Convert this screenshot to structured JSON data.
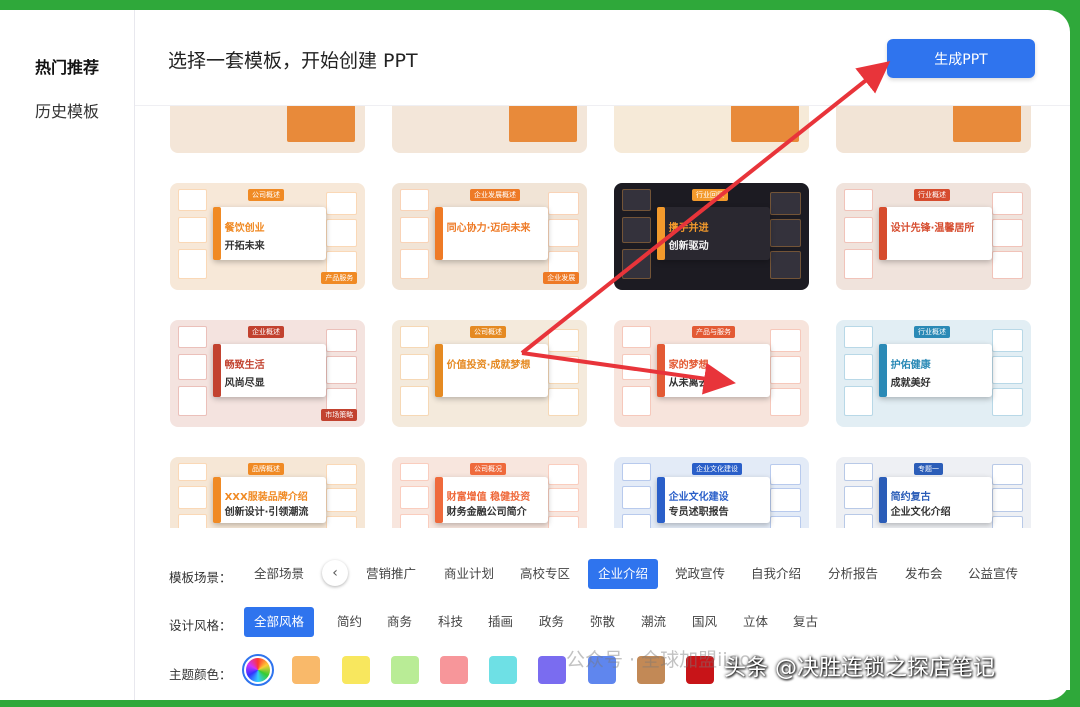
{
  "sidebar": {
    "items": [
      {
        "label": "热门推荐",
        "active": true
      },
      {
        "label": "历史模板",
        "active": false
      }
    ]
  },
  "header": {
    "title": "选择一套模板，开始创建 PPT",
    "generate_label": "生成PPT"
  },
  "templates": [
    {
      "headline": "餐饮创业",
      "subline": "开拓未来",
      "badge": "公司概述",
      "footer": "产品服务",
      "bg": "#f7e8d8",
      "accent": "#f08a24"
    },
    {
      "headline": "同心协力·迈向未来",
      "subline": "",
      "badge": "企业发展概述",
      "footer": "企业发展",
      "bg": "#f1e4d6",
      "accent": "#ee7a26"
    },
    {
      "headline": "携手并进",
      "subline": "创新驱动",
      "badge": "行业回顾",
      "footer": "",
      "bg": "#1c1b22",
      "accent": "#f39a2c"
    },
    {
      "headline": "设计先锋·温馨居所",
      "subline": "",
      "badge": "行业概述",
      "footer": "",
      "bg": "#f0e3dc",
      "accent": "#d64c2e"
    },
    {
      "headline": "畅致生活",
      "subline": "风尚尽显",
      "badge": "企业概述",
      "footer": "市场策略",
      "bg": "#f4e3df",
      "accent": "#c2422f"
    },
    {
      "headline": "价值投资·成就梦想",
      "subline": "",
      "badge": "公司概述",
      "footer": "",
      "bg": "#f4eadc",
      "accent": "#e58a22"
    },
    {
      "headline": "家的梦想",
      "subline": "从未离去",
      "badge": "产品与服务",
      "footer": "",
      "bg": "#f7e4dc",
      "accent": "#e35a34"
    },
    {
      "headline": "护佑健康",
      "subline": "成就美好",
      "badge": "行业概述",
      "footer": "",
      "bg": "#e2eef4",
      "accent": "#2b8ab6"
    },
    {
      "headline": "XXX服装品牌介绍",
      "subline": "创新设计·引领潮流",
      "badge": "品牌概述",
      "footer": "",
      "bg": "#f6e7d6",
      "accent": "#f08a24"
    },
    {
      "headline": "财富增值 稳健投资",
      "subline": "财务金融公司简介",
      "badge": "公司概况",
      "footer": "",
      "bg": "#f8e6de",
      "accent": "#ef6a3c"
    },
    {
      "headline": "企业文化建设",
      "subline": "专员述职报告",
      "badge": "企业文化建设",
      "footer": "",
      "bg": "#e3ebf7",
      "accent": "#2a5fc9"
    },
    {
      "headline": "简约复古",
      "subline": "企业文化介绍",
      "badge": "专题一",
      "footer": "",
      "bg": "#eef0f4",
      "accent": "#2b5db8"
    }
  ],
  "filters": {
    "scene": {
      "label": "模板场景：",
      "options": [
        "全部场景",
        "营销推广",
        "商业计划",
        "高校专区",
        "企业介绍",
        "党政宣传",
        "自我介绍",
        "分析报告",
        "发布会",
        "公益宣传"
      ],
      "selected": "企业介绍"
    },
    "style": {
      "label": "设计风格：",
      "options": [
        "全部风格",
        "简约",
        "商务",
        "科技",
        "插画",
        "政务",
        "弥散",
        "潮流",
        "国风",
        "立体",
        "复古"
      ],
      "selected": "全部风格"
    },
    "color": {
      "label": "主题颜色：",
      "swatches": [
        "rainbow",
        "#f9b96a",
        "#f8e75e",
        "#b9ec96",
        "#f7969a",
        "#6ee0e5",
        "#7a6cf0",
        "#5f86ee",
        "#c28956",
        "#c81418"
      ],
      "selected": "rainbow"
    }
  },
  "watermarks": {
    "faint": "公众号 · 全球加盟iieoo",
    "main": "头条 @决胜连锁之探店笔记"
  },
  "annotation": {
    "arrow_color": "#e8343a"
  }
}
